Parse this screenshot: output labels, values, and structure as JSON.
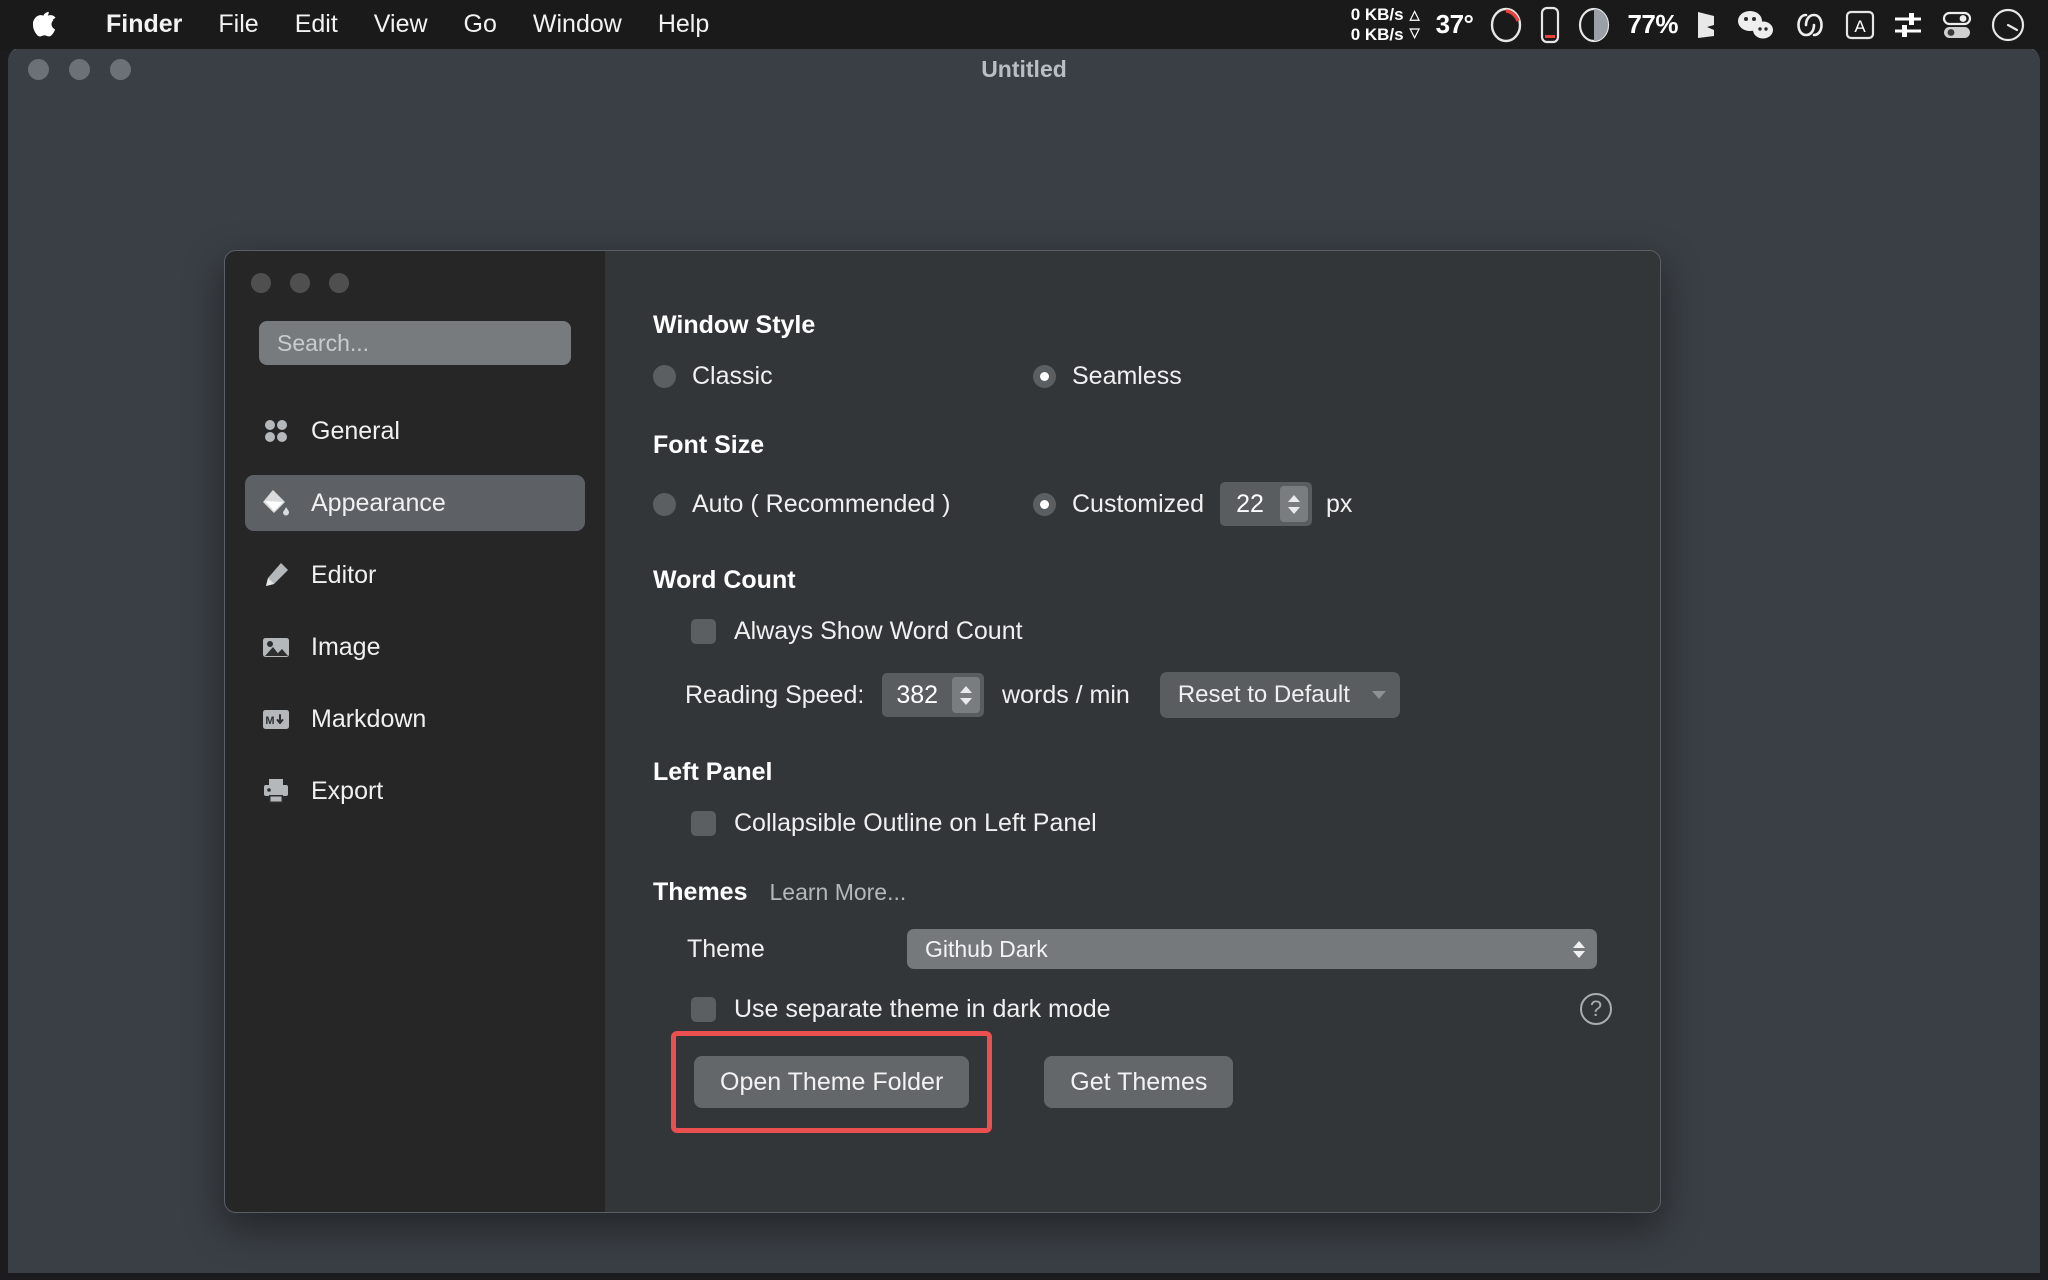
{
  "menubar": {
    "apple_icon": "apple-logo",
    "items": [
      {
        "label": "Finder",
        "bold": true
      },
      {
        "label": "File"
      },
      {
        "label": "Edit"
      },
      {
        "label": "View"
      },
      {
        "label": "Go"
      },
      {
        "label": "Window"
      },
      {
        "label": "Help"
      }
    ],
    "status": {
      "upload_rate": "0 KB/s",
      "download_rate": "0 KB/s",
      "upload_arrow": "△",
      "download_arrow": "▽",
      "temperature": "37°",
      "battery_percent": "77%",
      "icons": [
        "gauge-icon",
        "battery-icon",
        "disk-usage-icon",
        "stats-icon",
        "wechat-icon",
        "link-icon",
        "input-source-icon",
        "sliders-icon",
        "toggles-icon",
        "clock-icon"
      ]
    }
  },
  "outer_window": {
    "title": "Untitled",
    "traffic_lights": [
      "close",
      "minimize",
      "zoom"
    ]
  },
  "prefs": {
    "traffic_lights": [
      "close",
      "minimize",
      "zoom"
    ],
    "search": {
      "placeholder": "Search...",
      "value": ""
    },
    "sidebar": {
      "items": [
        {
          "label": "General",
          "icon": "grid-dots-icon",
          "selected": false
        },
        {
          "label": "Appearance",
          "icon": "paint-bucket-icon",
          "selected": true
        },
        {
          "label": "Editor",
          "icon": "pencil-icon",
          "selected": false
        },
        {
          "label": "Image",
          "icon": "photo-icon",
          "selected": false
        },
        {
          "label": "Markdown",
          "icon": "markdown-icon",
          "selected": false
        },
        {
          "label": "Export",
          "icon": "printer-icon",
          "selected": false
        }
      ]
    },
    "window_style": {
      "title": "Window Style",
      "classic_label": "Classic",
      "seamless_label": "Seamless",
      "selected": "Seamless"
    },
    "font_size": {
      "title": "Font Size",
      "auto_label": "Auto ( Recommended )",
      "customized_label": "Customized",
      "selected": "Customized",
      "value": "22",
      "unit": "px"
    },
    "word_count": {
      "title": "Word Count",
      "always_show_label": "Always Show Word Count",
      "always_show_checked": false,
      "reading_speed_label": "Reading Speed:",
      "reading_speed_value": "382",
      "reading_speed_unit": "words / min",
      "reset_button": "Reset to Default"
    },
    "left_panel": {
      "title": "Left Panel",
      "collapsible_label": "Collapsible Outline on Left Panel",
      "collapsible_checked": false
    },
    "themes": {
      "title": "Themes",
      "learn_more": "Learn More...",
      "theme_label": "Theme",
      "theme_value": "Github Dark",
      "separate_dark_label": "Use separate theme in dark mode",
      "separate_dark_checked": false,
      "open_folder_button": "Open Theme Folder",
      "get_themes_button": "Get Themes",
      "help_icon": "question-mark-icon",
      "highlight_color": "#e9504f"
    }
  }
}
